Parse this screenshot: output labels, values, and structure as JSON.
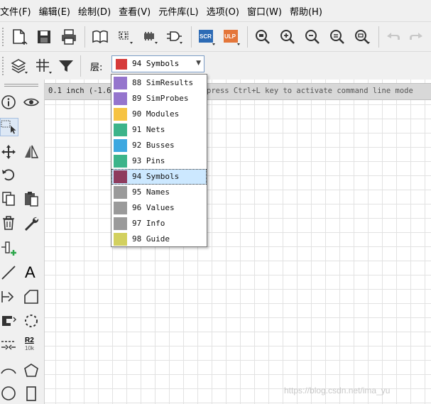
{
  "menu": [
    "文件(F)",
    "编辑(E)",
    "绘制(D)",
    "查看(V)",
    "元件库(L)",
    "选项(O)",
    "窗口(W)",
    "帮助(H)"
  ],
  "toolbar": {
    "scr_label": "SCR",
    "ulp_label": "ULP",
    "layer_label": "层:",
    "layer_selected": "94 Symbols",
    "layer_selected_color": "#d63b3b"
  },
  "commandline": {
    "coordinate": "0.1 inch (-1.6",
    "hint": "press Ctrl+L key to activate command line mode"
  },
  "layers": [
    {
      "label": "88 SimResults",
      "color": "#9575cd"
    },
    {
      "label": "89 SimProbes",
      "color": "#9575cd"
    },
    {
      "label": "90 Modules",
      "color": "#f6c343"
    },
    {
      "label": "91 Nets",
      "color": "#3cb48a"
    },
    {
      "label": "92 Busses",
      "color": "#3da8e0"
    },
    {
      "label": "93 Pins",
      "color": "#3cb48a"
    },
    {
      "label": "94 Symbols",
      "color": "#8e3b5e",
      "selected": true
    },
    {
      "label": "95 Names",
      "color": "#9a9a9a"
    },
    {
      "label": "96 Values",
      "color": "#9a9a9a"
    },
    {
      "label": "97 Info",
      "color": "#9a9a9a"
    },
    {
      "label": "98 Guide",
      "color": "#d2d05e"
    }
  ],
  "left_tools": {
    "value_tool_label": "R2",
    "value_tool_sublabel": "10k",
    "text_tool_label": "A"
  },
  "watermark": "https://blog.csdn.net/ima_yu"
}
